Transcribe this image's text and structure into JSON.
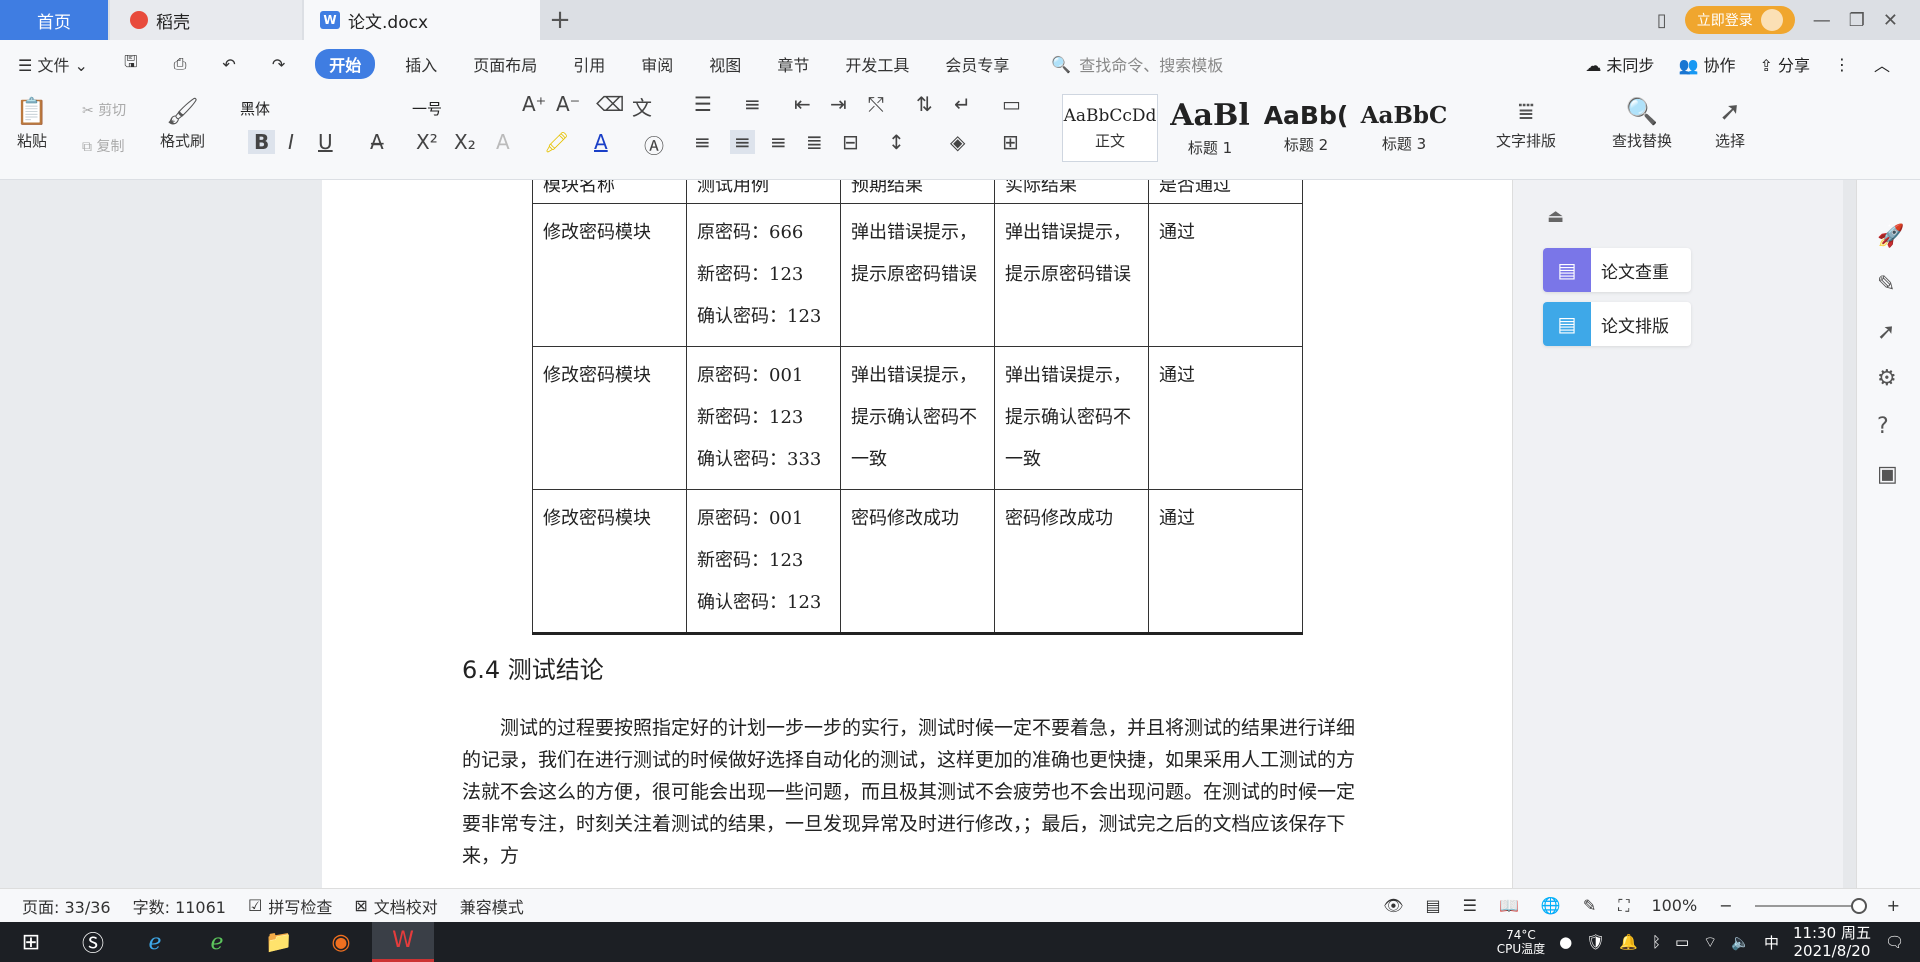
{
  "tabs": {
    "home": "首页",
    "daoke": "稻壳",
    "doc": "论文.docx",
    "login": "立即登录"
  },
  "menu": {
    "file": "文件",
    "start": "开始",
    "items": [
      "插入",
      "页面布局",
      "引用",
      "审阅",
      "视图",
      "章节",
      "开发工具",
      "会员专享"
    ],
    "search": "查找命令、搜索模板",
    "unsynced": "未同步",
    "collab": "协作",
    "share": "分享"
  },
  "ribbon": {
    "paste": "粘贴",
    "cut": "剪切",
    "copy": "复制",
    "format_painter": "格式刷",
    "font_name": "黑体",
    "font_size": "一号",
    "styles": [
      {
        "sample": "AaBbCcDd",
        "name": "正文"
      },
      {
        "sample": "AaBl",
        "name": "标题 1"
      },
      {
        "sample": "AaBb(",
        "name": "标题 2"
      },
      {
        "sample": "AaBbC",
        "name": "标题 3"
      }
    ],
    "text_layout": "文字排版",
    "find_replace": "查找替换",
    "select": "选择"
  },
  "table": {
    "headers": [
      "模块名称",
      "测试用例",
      "预期结果",
      "实际结果",
      "是否通过"
    ],
    "rows": [
      [
        "修改密码模块",
        "原密码：666\n新密码：123\n确认密码：123",
        "弹出错误提示，提示原密码错误",
        "弹出错误提示，提示原密码错误",
        "通过"
      ],
      [
        "修改密码模块",
        "原密码：001\n新密码：123\n确认密码：333",
        "弹出错误提示，提示确认密码不一致",
        "弹出错误提示，提示确认密码不一致",
        "通过"
      ],
      [
        "修改密码模块",
        "原密码：001\n新密码：123\n确认密码：123",
        "密码修改成功",
        "密码修改成功",
        "通过"
      ]
    ]
  },
  "section_title": "6.4   测试结论",
  "body_text": "测试的过程要按照指定好的计划一步一步的实行，测试时候一定不要着急，并且将测试的结果进行详细的记录，我们在进行测试的时候做好选择自动化的测试，这样更加的准确也更快捷，如果采用人工测试的方法就不会这么的方便，很可能会出现一些问题，而且极其测试不会疲劳也不会出现问题。在测试的时候一定要非常专注，时刻关注着测试的结果，一旦发现异常及时进行修改，；最后，测试完之后的文档应该保存下来，方",
  "side_panel": {
    "check": "论文查重",
    "layout": "论文排版"
  },
  "status": {
    "page": "页面: 33/36",
    "words": "字数: 11061",
    "spell": "拼写检查",
    "proof": "文档校对",
    "compat": "兼容模式",
    "zoom": "100%"
  },
  "taskbar": {
    "temp": "74°C",
    "cpu": "CPU温度",
    "ime": "中",
    "time": "11:30 周五",
    "date": "2021/8/20"
  }
}
